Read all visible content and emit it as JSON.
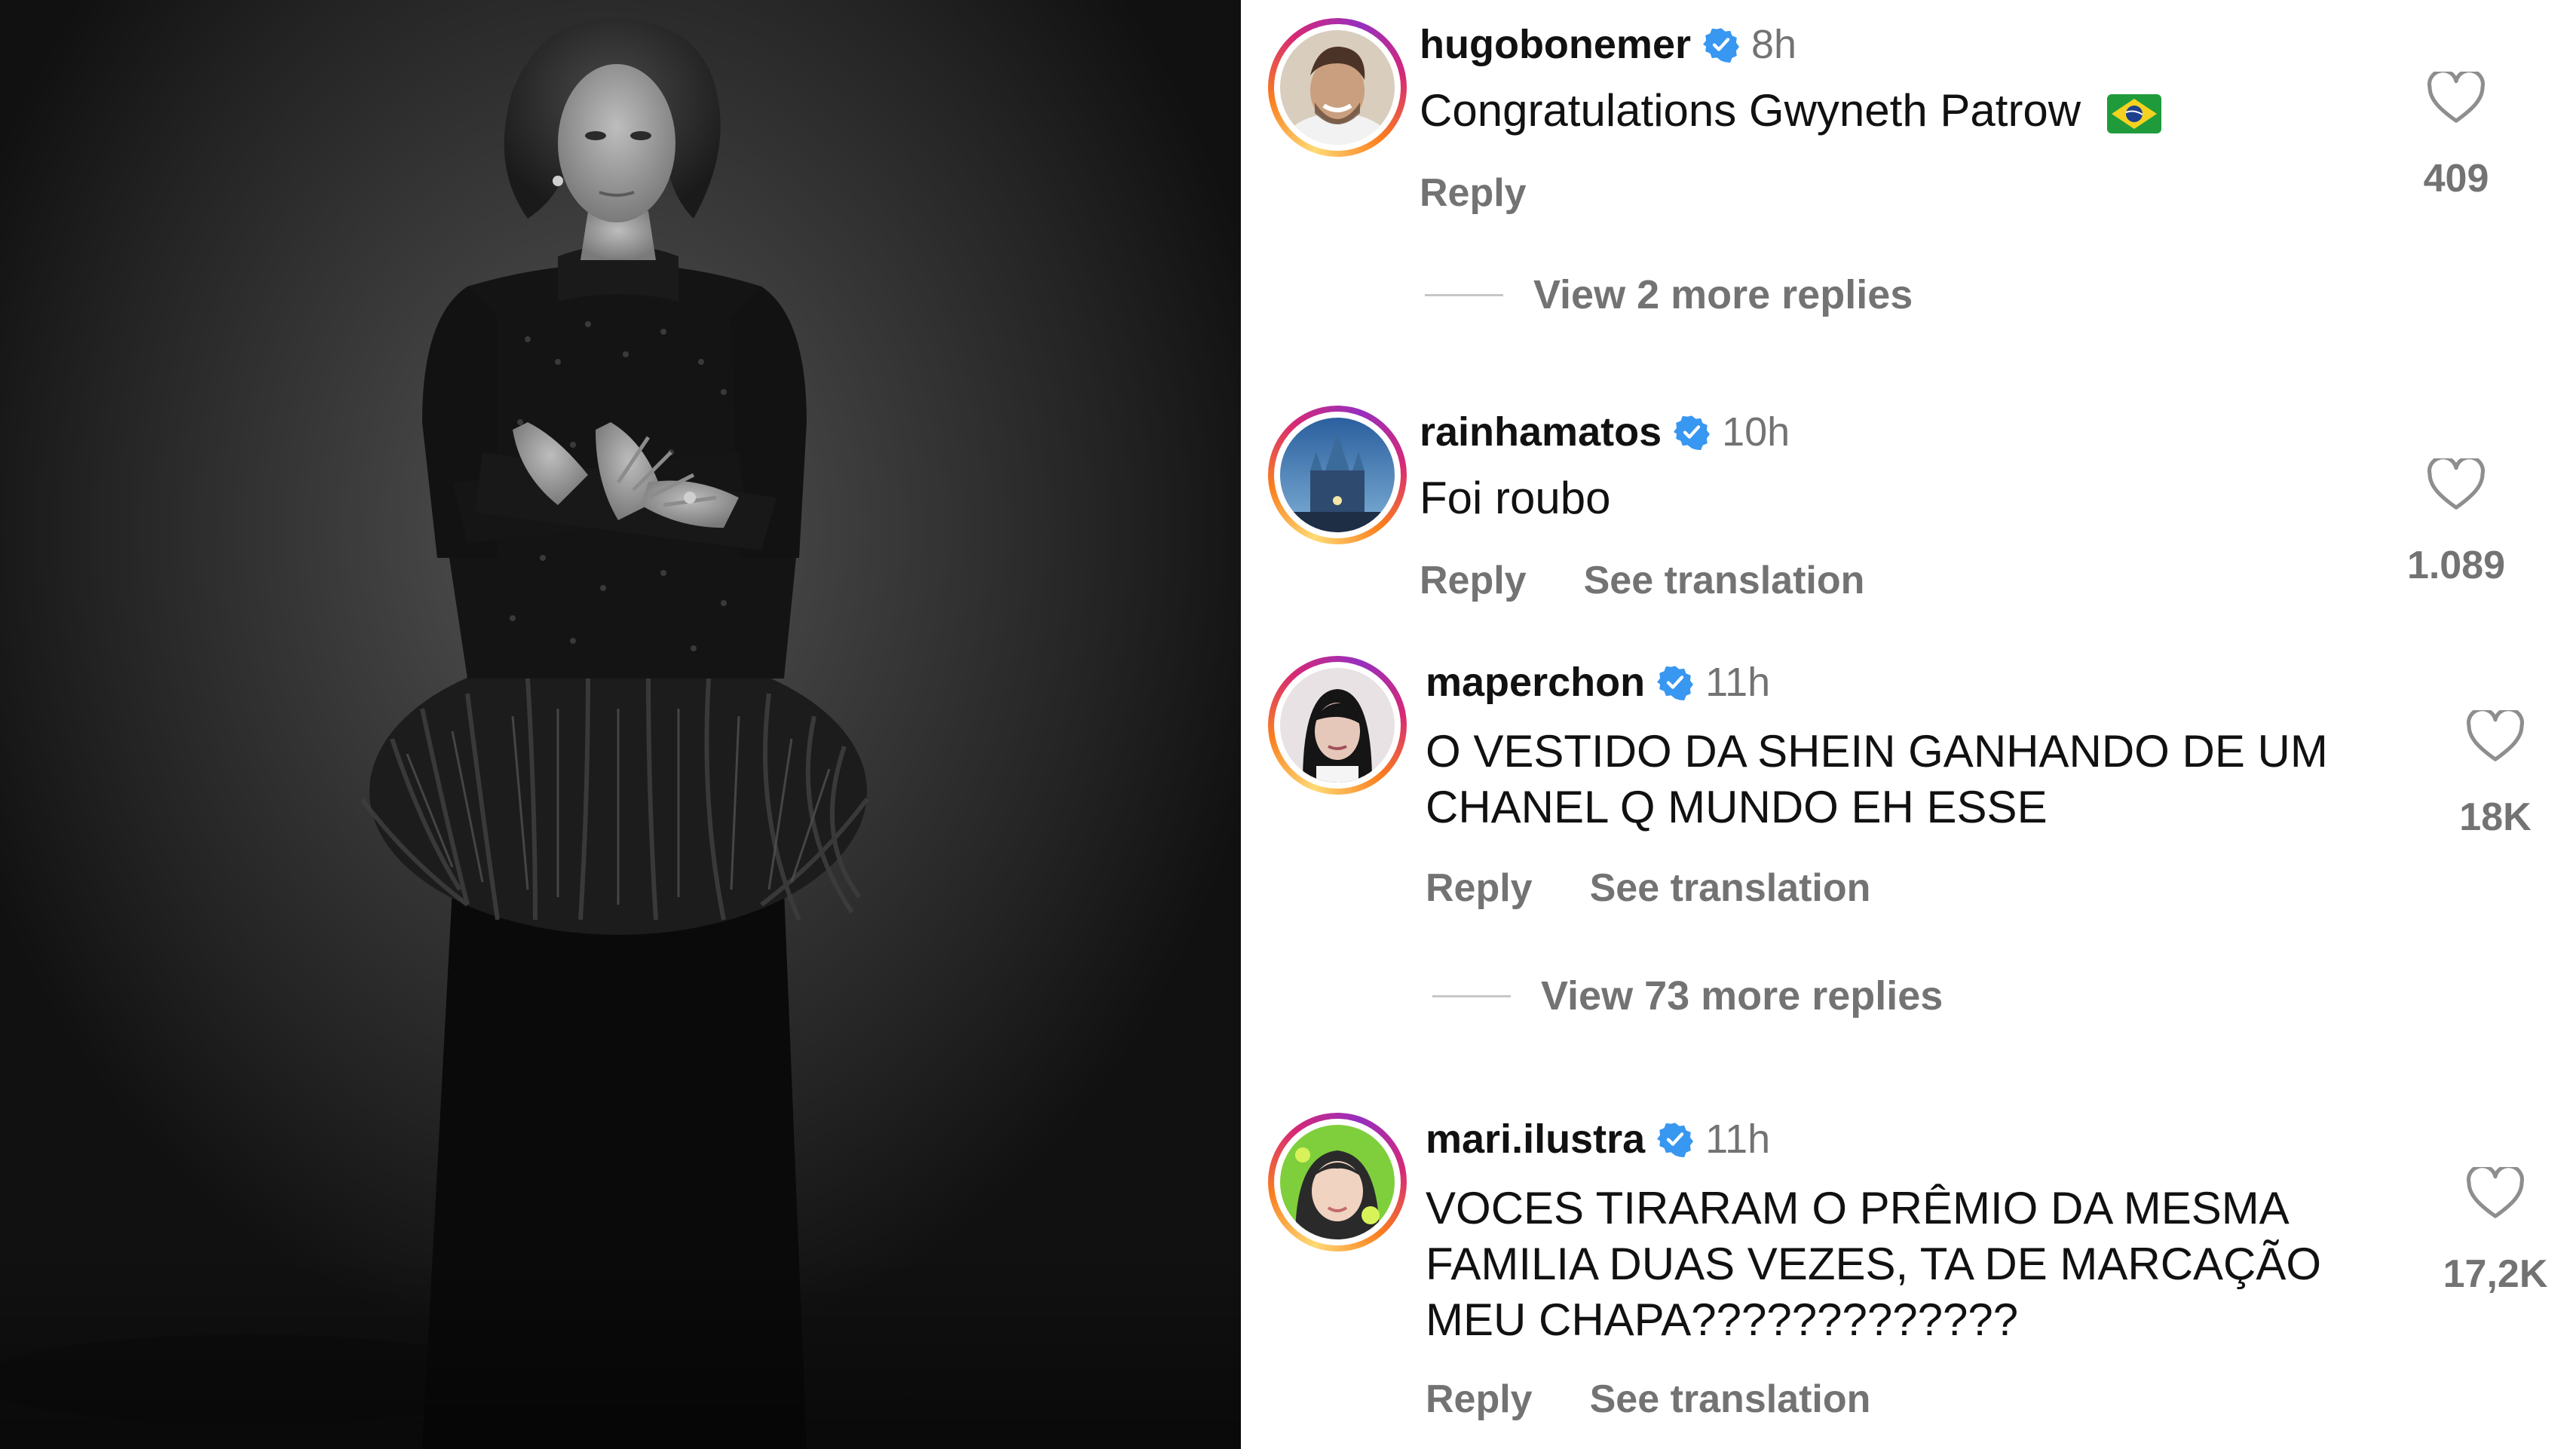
{
  "photo": {
    "alt_icon": "portrait-photo"
  },
  "colors": {
    "verified": "#3897f0",
    "secondary_text": "#737373",
    "primary_text": "#111111",
    "story_ring": "#d62976"
  },
  "comments": [
    {
      "username": "hugobonemer",
      "time": "8h",
      "text_lines": [
        "Congratulations Gwyneth Patrow"
      ],
      "flag_icon": "brazil-flag-icon",
      "actions": [
        "Reply"
      ],
      "likes": "409",
      "more_replies": "View 2 more replies"
    },
    {
      "username": "rainhamatos",
      "time": "10h",
      "text_lines": [
        "Foi roubo"
      ],
      "actions": [
        "Reply",
        "See translation"
      ],
      "likes": "1.089"
    },
    {
      "username": "maperchon",
      "time": "11h",
      "text_lines": [
        "O VESTIDO DA SHEIN GANHANDO DE UM",
        "CHANEL Q MUNDO EH ESSE"
      ],
      "actions": [
        "Reply",
        "See translation"
      ],
      "likes": "18K",
      "more_replies": "View 73 more replies"
    },
    {
      "username": "mari.ilustra",
      "time": "11h",
      "text_lines": [
        "VOCES TIRARAM O PRÊMIO DA MESMA",
        "FAMILIA DUAS VEZES, TA DE MARCAÇÃO",
        "MEU CHAPA?????????????"
      ],
      "actions": [
        "Reply",
        "See translation"
      ],
      "likes": "17,2K"
    }
  ]
}
